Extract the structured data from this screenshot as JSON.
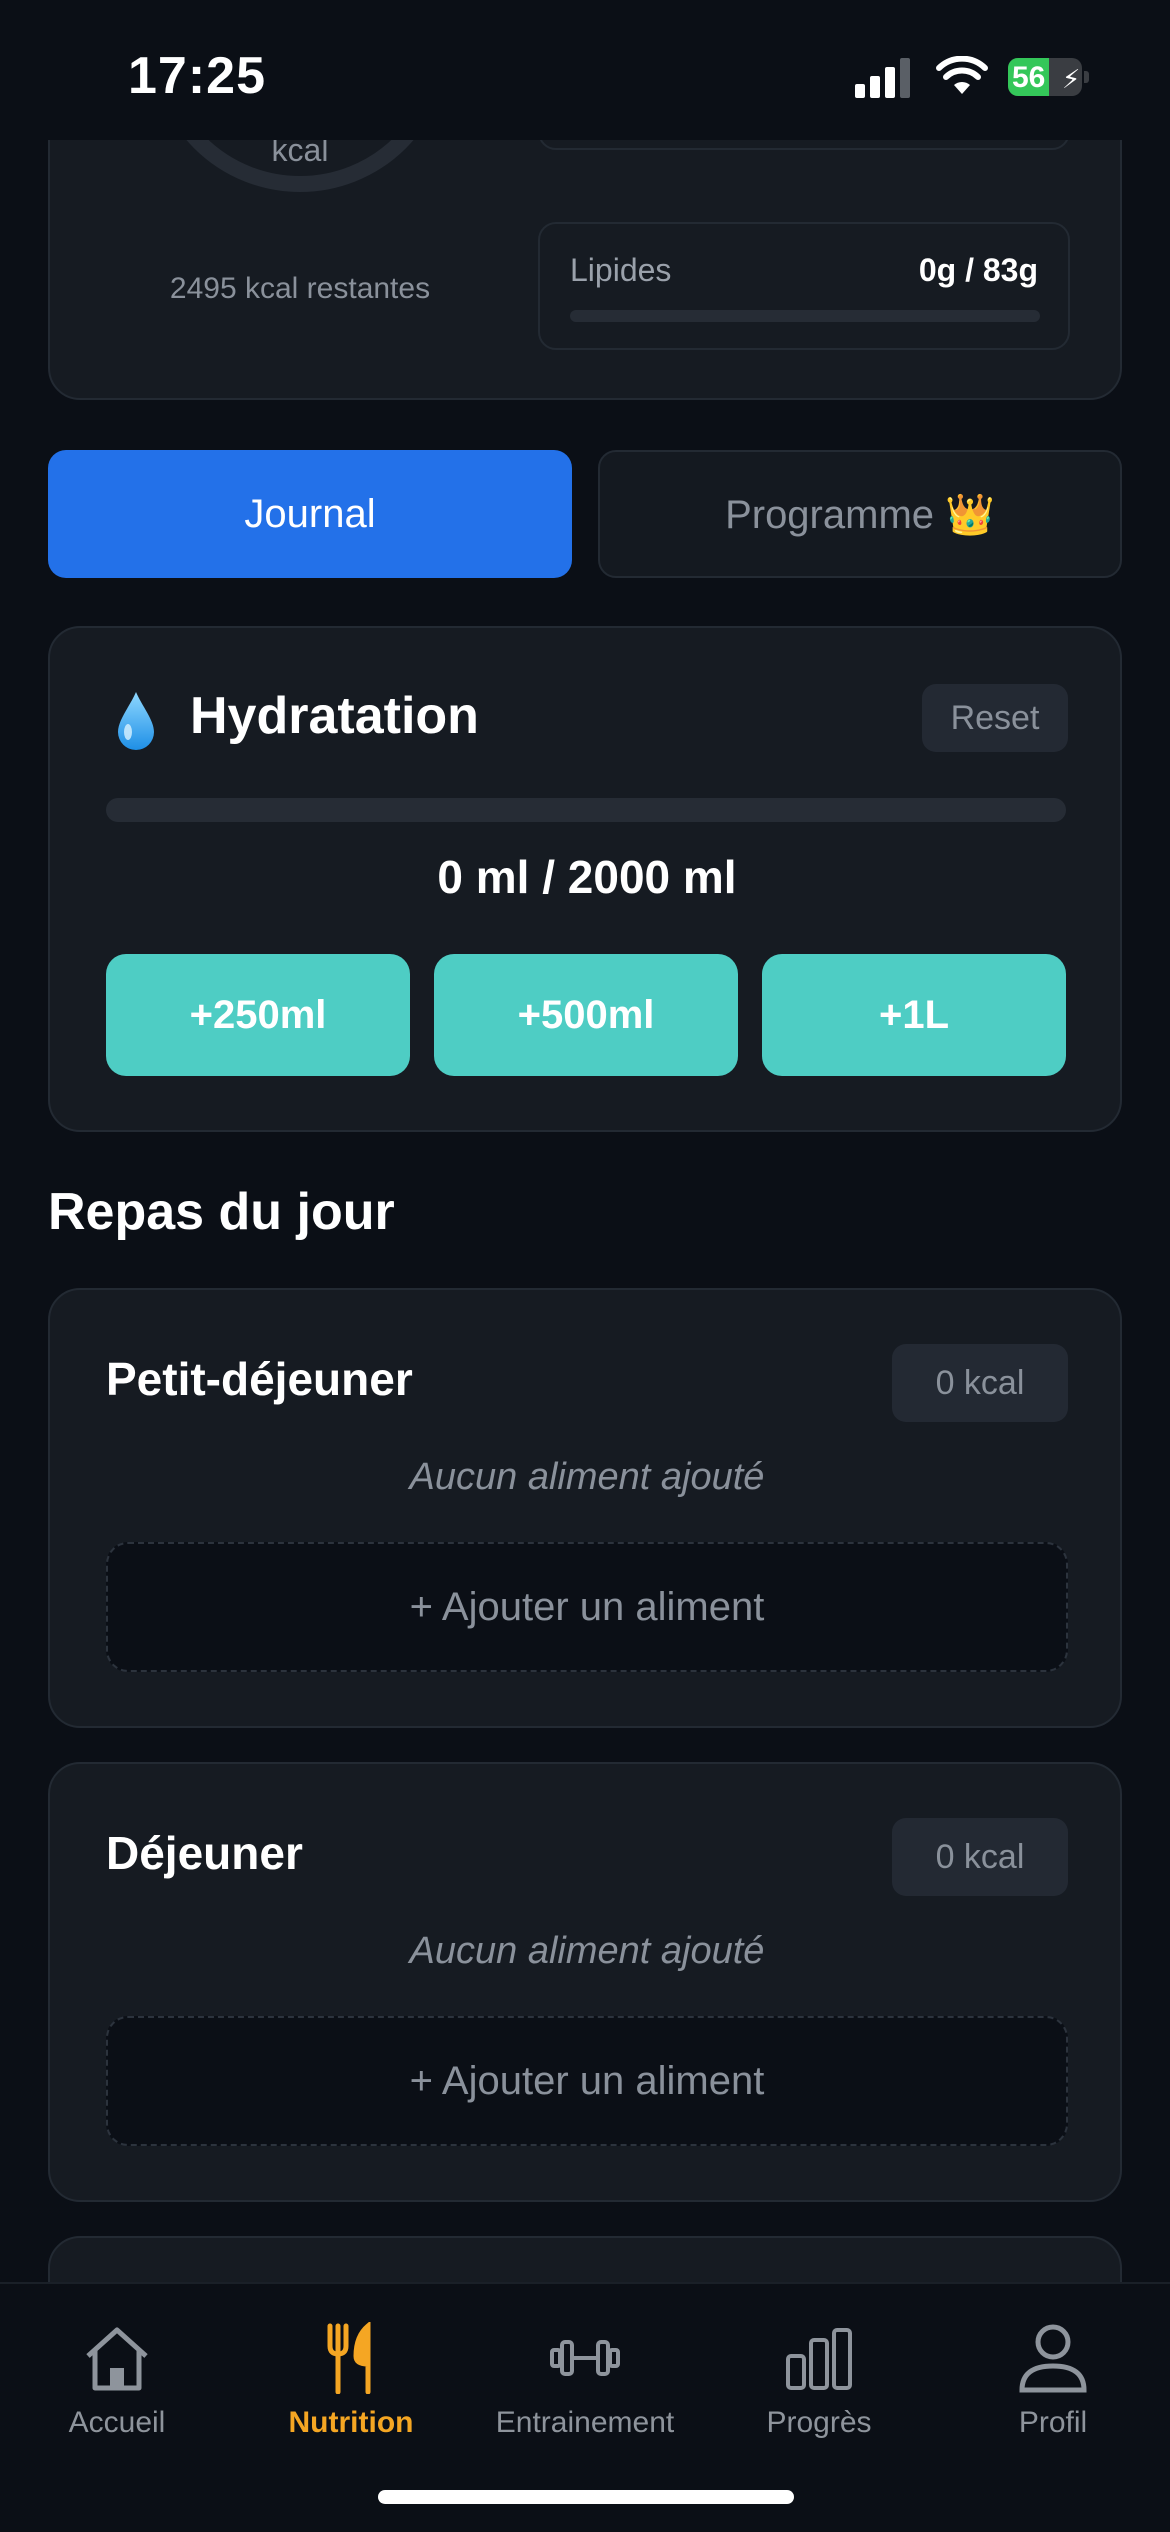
{
  "status_bar": {
    "time": "17:25",
    "battery_level": "56",
    "battery_fraction": 0.56
  },
  "summary": {
    "ring_unit": "kcal",
    "remaining": "2495 kcal restantes",
    "macros": [
      {
        "label": "Lipides",
        "value": "0g / 83g"
      }
    ]
  },
  "tabs": [
    {
      "label": "Journal",
      "active": true
    },
    {
      "label": "Programme 👑",
      "active": false
    }
  ],
  "hydration": {
    "title": "Hydratation",
    "reset_label": "Reset",
    "amount": "0 ml / 2000 ml",
    "progress": 0,
    "buttons": [
      "+250ml",
      "+500ml",
      "+1L"
    ]
  },
  "meals": {
    "title": "Repas du jour",
    "items": [
      {
        "name": "Petit-déjeuner",
        "kcal": "0 kcal",
        "empty_text": "Aucun aliment ajouté",
        "add_label": "+ Ajouter un aliment"
      },
      {
        "name": "Déjeuner",
        "kcal": "0 kcal",
        "empty_text": "Aucun aliment ajouté",
        "add_label": "+ Ajouter un aliment"
      }
    ]
  },
  "nav": {
    "items": [
      {
        "label": "Accueil",
        "icon": "home-icon"
      },
      {
        "label": "Nutrition",
        "icon": "fork-knife-icon",
        "active": true
      },
      {
        "label": "Entrainement",
        "icon": "dumbbell-icon"
      },
      {
        "label": "Progrès",
        "icon": "bar-chart-icon"
      },
      {
        "label": "Profil",
        "icon": "user-icon"
      }
    ]
  },
  "colors": {
    "background": "#0b0f16",
    "card": "#161b22",
    "accent_blue": "#2371e9",
    "water_teal": "#4ecdc4",
    "nav_active": "#f5a623"
  }
}
